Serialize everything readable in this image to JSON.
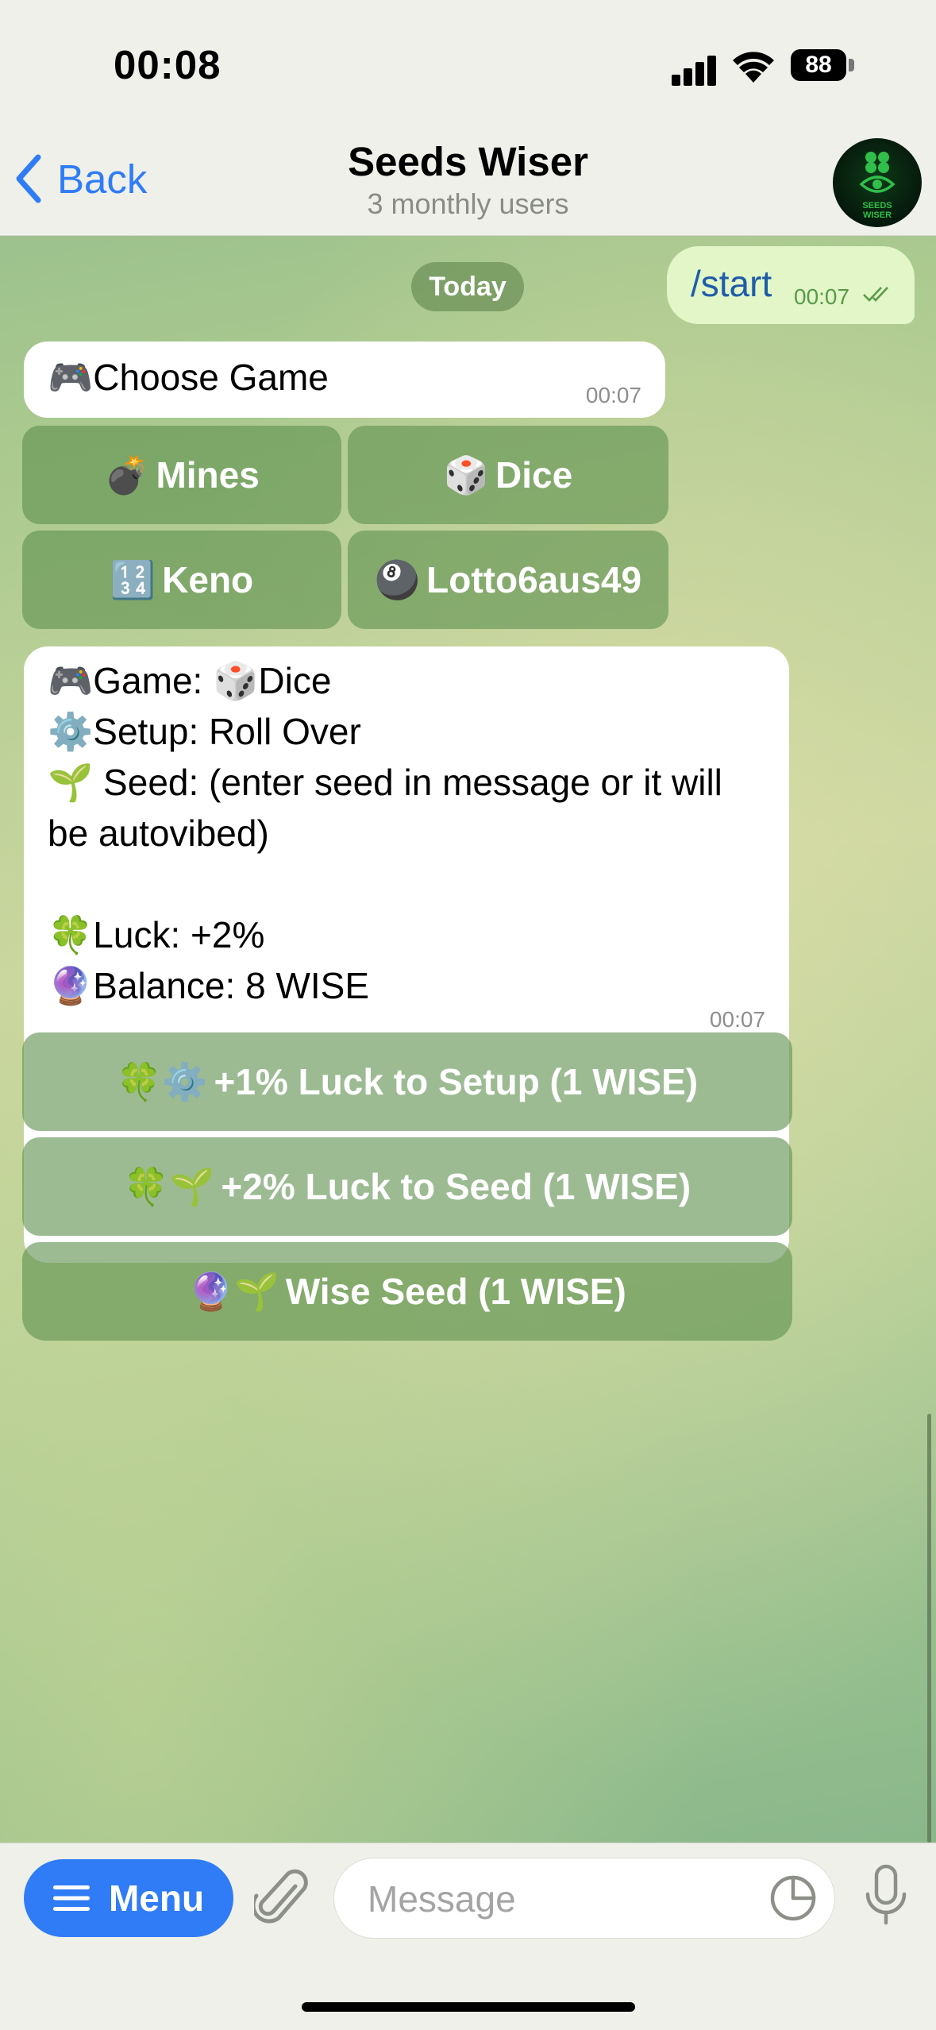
{
  "status": {
    "time": "00:08",
    "battery": "88"
  },
  "header": {
    "back_label": "Back",
    "title": "Seeds Wiser",
    "subtitle": "3 monthly users",
    "avatar_text": "SEEDS WISER"
  },
  "chat": {
    "date_label": "Today",
    "outgoing": {
      "text": "/start",
      "time": "00:07"
    },
    "message1": {
      "emoji": "🎮",
      "text": "Choose Game",
      "time": "00:07"
    },
    "games": [
      {
        "emoji": "💣",
        "label": "Mines"
      },
      {
        "emoji": "🎲",
        "label": "Dice"
      },
      {
        "emoji": "🔢",
        "label": "Keno"
      },
      {
        "emoji": "🎱",
        "label": "Lotto6aus49"
      }
    ],
    "message2": {
      "game_emoji": "🎮",
      "game_label": "Game:",
      "game_icon": "🎲",
      "game_value": "Dice",
      "setup_emoji": "⚙️",
      "setup": "Setup: Roll Over",
      "seed_emoji": "🌱",
      "seed_line1": " Seed: (enter seed in message or it will",
      "seed_line2": "be autovibed)",
      "luck_emoji": "🍀",
      "luck": "Luck: +2%",
      "balance_emoji": "🔮",
      "balance": "Balance: 8 WISE",
      "time": "00:07"
    },
    "actions": [
      {
        "emoji": "🍀⚙️",
        "label": "+1% Luck to Setup (1 WISE)"
      },
      {
        "emoji": "🍀🌱",
        "label": "+2% Luck to Seed (1 WISE)"
      },
      {
        "emoji": "🔮🌱",
        "label": "Wise Seed (1 WISE)"
      }
    ]
  },
  "input": {
    "menu_label": "Menu",
    "placeholder": "Message"
  }
}
